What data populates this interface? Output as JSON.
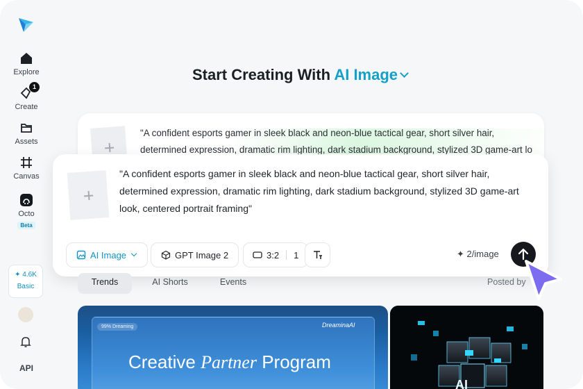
{
  "sidebar": {
    "items": [
      {
        "label": "Explore",
        "icon": "home-icon"
      },
      {
        "label": "Create",
        "icon": "create-icon",
        "badge": "1"
      },
      {
        "label": "Assets",
        "icon": "folder-icon"
      },
      {
        "label": "Canvas",
        "icon": "canvas-icon"
      },
      {
        "label": "Octo",
        "icon": "octo-icon",
        "badge": "Beta"
      }
    ],
    "credits": {
      "amount": "4.6K",
      "plan": "Basic"
    },
    "api_label": "API"
  },
  "headline": {
    "prefix": "Start Creating With",
    "mode": "AI Image"
  },
  "prompt_back": "\"A confident esports gamer in sleek black and neon-blue tactical gear, short silver hair, determined expression, dramatic rim lighting, dark stadium background, stylized 3D game-art lo",
  "prompt": "\"A confident esports gamer in sleek black and neon-blue tactical gear, short silver hair, determined expression, dramatic rim lighting, dark stadium background, stylized 3D game-art look, centered portrait framing\"",
  "toolbar": {
    "mode_label": "AI Image",
    "model_label": "GPT Image 2",
    "ratio_label": "3:2",
    "count_label": "1",
    "cost_label": "2/image"
  },
  "tabs": [
    "Trends",
    "AI Shorts",
    "Events"
  ],
  "posted_label": "Posted by",
  "media": {
    "tag": "99% Dreaming",
    "brand": "DreaminaAI",
    "title_a": "Creative",
    "title_b": "Partner",
    "title_c": "Program",
    "badge2": "AI"
  },
  "colors": {
    "accent": "#14a0c8",
    "send": "#15181c",
    "cursor": "#7c6cf0"
  }
}
